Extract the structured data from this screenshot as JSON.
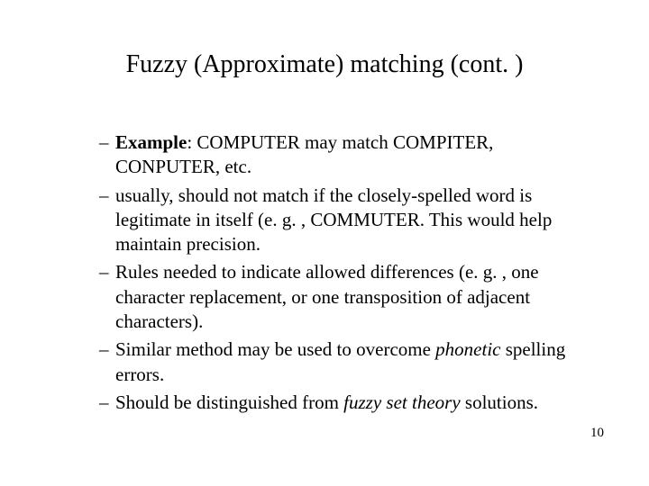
{
  "title": "Fuzzy (Approximate) matching (cont. )",
  "dash": "–",
  "bullets": [
    {
      "pre": "",
      "bold": "Example",
      "post": ": COMPUTER may match COMPITER, CONPUTER, etc.",
      "italic": "",
      "tail": ""
    },
    {
      "pre": "usually, should not match if the closely-spelled word is legitimate in itself (e. g. , COMMUTER. This would help maintain precision.",
      "bold": "",
      "post": "",
      "italic": "",
      "tail": ""
    },
    {
      "pre": "Rules needed to indicate allowed differences (e. g. , one character replacement, or one transposition of adjacent characters).",
      "bold": "",
      "post": "",
      "italic": "",
      "tail": ""
    },
    {
      "pre": "Similar method may be used to overcome ",
      "bold": "",
      "post": "",
      "italic": "phonetic",
      "tail": " spelling errors."
    },
    {
      "pre": "Should be distinguished from ",
      "bold": "",
      "post": "",
      "italic": "fuzzy set theory",
      "tail": " solutions."
    }
  ],
  "page_number": "10"
}
